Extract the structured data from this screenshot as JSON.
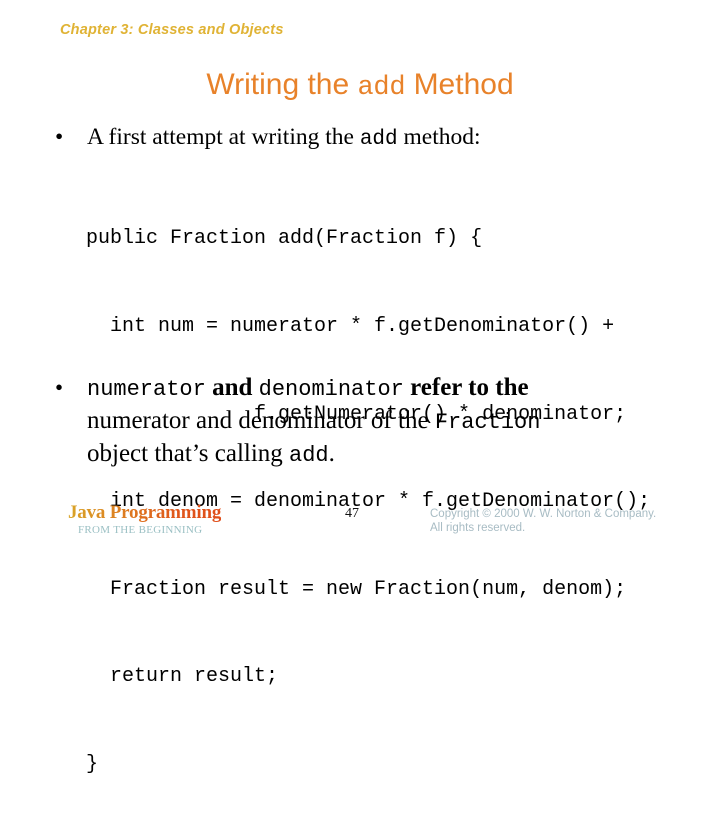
{
  "slide": {
    "chapter_header": "Chapter 3: Classes and Objects",
    "title_prefix": "Writing the ",
    "title_code": "add",
    "title_suffix": " Method"
  },
  "bullet_one": {
    "marker": "•",
    "text_before": "A first attempt at writing the ",
    "code": "add",
    "text_after": " method:"
  },
  "code_block": {
    "lines": [
      "public Fraction add(Fraction f) {",
      "  int num = numerator * f.getDenominator() +",
      "              f.getNumerator() * denominator;",
      "  int denom = denominator * f.getDenominator();",
      "  Fraction result = new Fraction(num, denom);",
      "  return result;",
      "}"
    ]
  },
  "bullet_two": {
    "marker": "•",
    "line1_code1": "numerator",
    "line1_and": " and ",
    "line1_code2": "denominator",
    "line1_tail": " refer to the",
    "line2_text": "numerator and denominator of the ",
    "line2_code": "Fraction",
    "line3_text": "object that’s calling ",
    "line3_code": "add",
    "line3_tail": "."
  },
  "footer": {
    "logo_main": "Java Programming",
    "logo_sub": "FROM THE BEGINNING",
    "page_number": "47",
    "copyright_line1": "Copyright © 2000 W. W. Norton & Company.",
    "copyright_line2": "All rights reserved."
  },
  "colors": {
    "chapter_header": "#e0b335",
    "title": "#e8822a",
    "logo_gradient_start": "#d9a528",
    "logo_gradient_end": "#e04e1a",
    "logo_sub": "#9bc0c4",
    "copyright": "#a8bcc4",
    "body_text": "#000000",
    "background": "#ffffff"
  }
}
